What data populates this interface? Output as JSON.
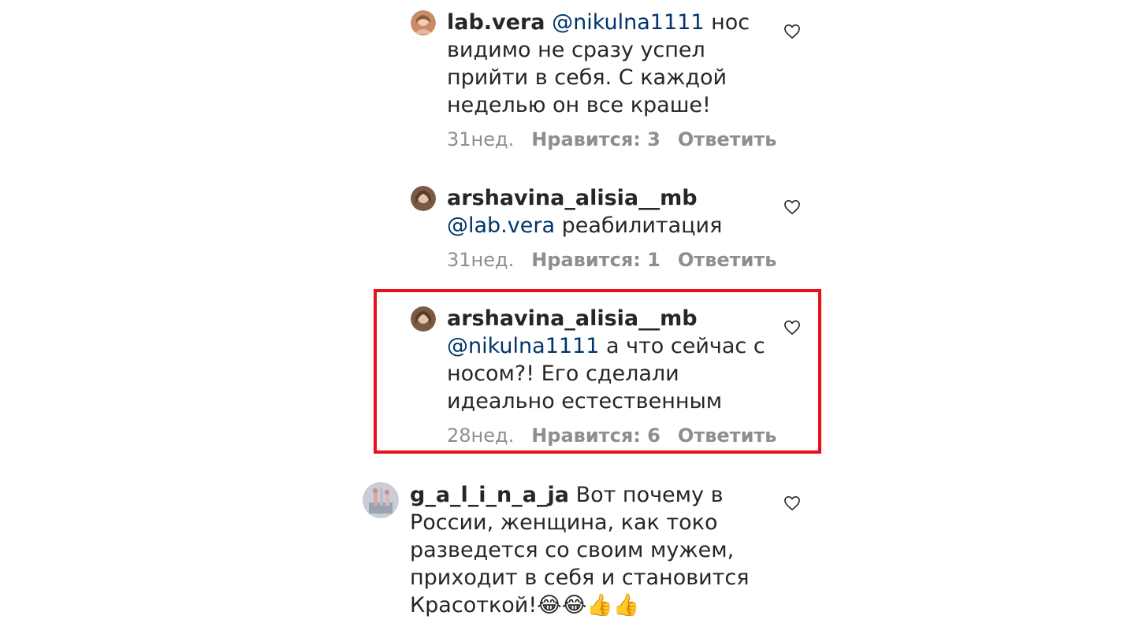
{
  "colors": {
    "text": "#262626",
    "mention": "#003569",
    "meta": "#8e8e8e",
    "highlight_border": "#e8101b"
  },
  "comments": [
    {
      "username": "lab.vera",
      "mention": "@nikulna1111",
      "text_lines": [
        "нос",
        "видимо не сразу успел",
        "прийти в себя. С каждой",
        "неделью он все краше!"
      ],
      "time": "31нед.",
      "likes": "Нравится: 3",
      "reply": "Ответить",
      "like_icon": "heart-outline-icon"
    },
    {
      "username": "arshavina_alisia__mb",
      "mention": "@lab.vera",
      "text_lines": [
        "реабилитация"
      ],
      "time": "31нед.",
      "likes": "Нравится: 1",
      "reply": "Ответить",
      "like_icon": "heart-outline-icon"
    },
    {
      "username": "arshavina_alisia__mb",
      "mention": "@nikulna1111",
      "text_lines": [
        "а что сейчас с",
        "носом?! Его сделали",
        "идеально естественным"
      ],
      "time": "28нед.",
      "likes": "Нравится: 6",
      "reply": "Ответить",
      "like_icon": "heart-outline-icon",
      "highlighted": true
    },
    {
      "username": "g_a_l_i_n_a_ja",
      "mention": "",
      "text_lines": [
        "Вот почему в",
        "России, женщина, как токо",
        "разведется со своим мужем,",
        "приходит в себя и становится",
        "Красоткой!😂😂👍👍"
      ],
      "like_icon": "heart-outline-icon"
    }
  ]
}
